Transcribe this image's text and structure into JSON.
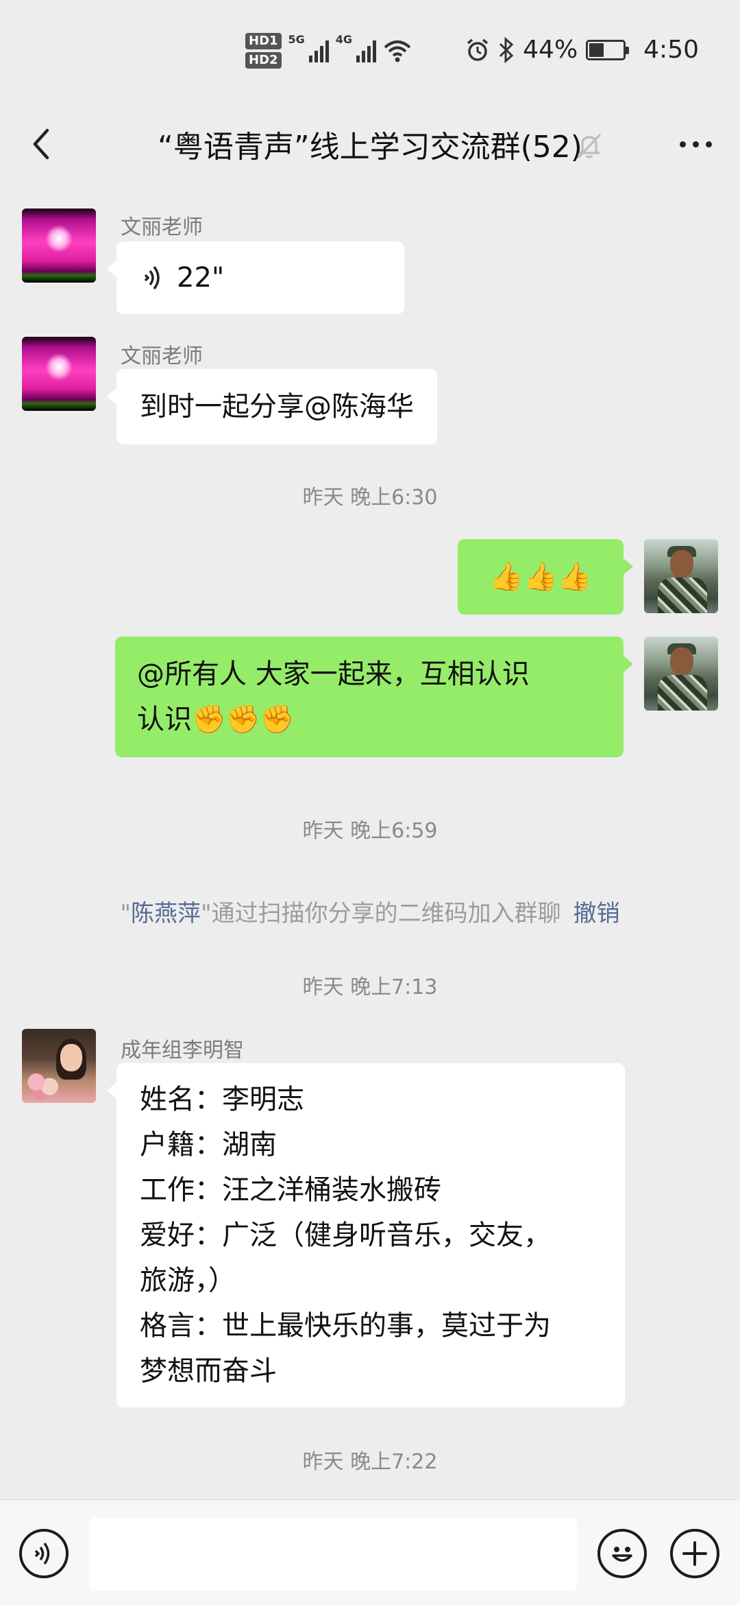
{
  "status_bar": {
    "hd1": "HD1",
    "hd2": "HD2",
    "net1": "5G",
    "net2": "4G",
    "battery_text": "44%",
    "battery_level": 0.44,
    "time": "4:50"
  },
  "header": {
    "title": "“粤语青声”线上学习交流群(52)"
  },
  "messages": [
    {
      "sender": "文丽老师",
      "voice_duration": "22\""
    },
    {
      "sender": "文丽老师",
      "text": "到时一起分享@陈海华"
    },
    {
      "time": "昨天 晚上6:30"
    },
    {
      "text": "👍👍👍"
    },
    {
      "line1": "@所有人   大家一起来，互相认识",
      "line2": "认识✊✊✊"
    },
    {
      "time": "昨天 晚上6:59"
    },
    {
      "system_prefix": "\"",
      "system_name": "陈燕萍",
      "system_text": "\"通过扫描你分享的二维码加入群聊",
      "system_action": "撤销"
    },
    {
      "time": "昨天 晚上7:13"
    },
    {
      "sender": "成年组李明智",
      "lines": [
        "姓名：李明志",
        "户籍：湖南",
        "工作：汪之洋桶装水搬砖",
        "爱好：广泛（健身听音乐，交友，",
        "旅游，）",
        "格言：世上最快乐的事，莫过于为",
        "梦想而奋斗"
      ]
    },
    {
      "time": "昨天 晚上7:22"
    }
  ],
  "input": {
    "placeholder": ""
  },
  "icons": {
    "back": "chevron-left-icon",
    "mute": "bell-off-icon",
    "more": "more-icon",
    "voice": "voice-icon",
    "emoji": "emoji-icon",
    "plus": "plus-icon"
  },
  "colors": {
    "background": "#ededed",
    "bubble_self": "#95ec69",
    "bubble_other": "#ffffff",
    "link": "#576b95"
  }
}
